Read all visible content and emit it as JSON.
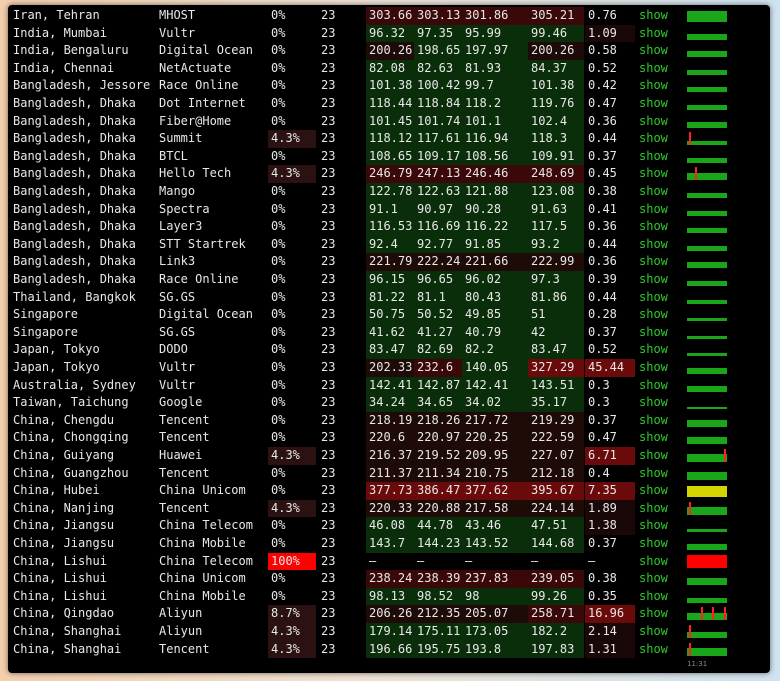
{
  "rows": [
    {
      "location": "Iran, Tehran",
      "provider": "MHOST",
      "loss": "0%",
      "count": "23",
      "avg": "303.66",
      "best": "303.13",
      "median": "301.86",
      "worst": "305.21",
      "stdev": "0.76",
      "show": "show",
      "graph": {
        "level": 0.85,
        "color": "#1aa61a",
        "spikes": []
      }
    },
    {
      "location": "India, Mumbai",
      "provider": "Vultr",
      "loss": "0%",
      "count": "23",
      "avg": "96.32",
      "best": "97.35",
      "median": "95.99",
      "worst": "99.46",
      "stdev": "1.09",
      "show": "show",
      "graph": {
        "level": 0.4,
        "color": "#1aa61a",
        "spikes": []
      }
    },
    {
      "location": "India, Bengaluru",
      "provider": "Digital Ocean",
      "loss": "0%",
      "count": "23",
      "avg": "200.26",
      "best": "198.65",
      "median": "197.97",
      "worst": "200.26",
      "stdev": "0.58",
      "show": "show",
      "graph": {
        "level": 0.5,
        "color": "#1aa61a",
        "spikes": []
      }
    },
    {
      "location": "India, Chennai",
      "provider": "NetActuate",
      "loss": "0%",
      "count": "23",
      "avg": "82.08",
      "best": "82.63",
      "median": "81.93",
      "worst": "84.37",
      "stdev": "0.52",
      "show": "show",
      "graph": {
        "level": 0.4,
        "color": "#1aa61a",
        "spikes": []
      }
    },
    {
      "location": "Bangladesh, Jessore",
      "provider": "Race Online",
      "loss": "0%",
      "count": "23",
      "avg": "101.38",
      "best": "100.42",
      "median": "99.7",
      "worst": "101.38",
      "stdev": "0.42",
      "show": "show",
      "graph": {
        "level": 0.4,
        "color": "#1aa61a",
        "spikes": []
      }
    },
    {
      "location": "Bangladesh, Dhaka",
      "provider": "Dot Internet",
      "loss": "0%",
      "count": "23",
      "avg": "118.44",
      "best": "118.84",
      "median": "118.2",
      "worst": "119.76",
      "stdev": "0.47",
      "show": "show",
      "graph": {
        "level": 0.4,
        "color": "#1aa61a",
        "spikes": []
      }
    },
    {
      "location": "Bangladesh, Dhaka",
      "provider": "Fiber@Home",
      "loss": "0%",
      "count": "23",
      "avg": "101.45",
      "best": "101.74",
      "median": "101.1",
      "worst": "102.4",
      "stdev": "0.36",
      "show": "show",
      "graph": {
        "level": 0.4,
        "color": "#1aa61a",
        "spikes": []
      }
    },
    {
      "location": "Bangladesh, Dhaka",
      "provider": "Summit",
      "loss": "4.3%",
      "count": "23",
      "avg": "118.12",
      "best": "117.61",
      "median": "116.94",
      "worst": "118.3",
      "stdev": "0.44",
      "show": "show",
      "graph": {
        "level": 0.35,
        "color": "#1aa61a",
        "spikes": [
          0.06
        ]
      }
    },
    {
      "location": "Bangladesh, Dhaka",
      "provider": "BTCL",
      "loss": "0%",
      "count": "23",
      "avg": "108.65",
      "best": "109.17",
      "median": "108.56",
      "worst": "109.91",
      "stdev": "0.37",
      "show": "show",
      "graph": {
        "level": 0.4,
        "color": "#1aa61a",
        "spikes": []
      }
    },
    {
      "location": "Bangladesh, Dhaka",
      "provider": "Hello Tech",
      "loss": "4.3%",
      "count": "23",
      "avg": "246.79",
      "best": "247.13",
      "median": "246.46",
      "worst": "248.69",
      "stdev": "0.45",
      "show": "show",
      "graph": {
        "level": 0.55,
        "color": "#1aa61a",
        "spikes": [
          0.2
        ]
      }
    },
    {
      "location": "Bangladesh, Dhaka",
      "provider": "Mango",
      "loss": "0%",
      "count": "23",
      "avg": "122.78",
      "best": "122.63",
      "median": "121.88",
      "worst": "123.08",
      "stdev": "0.38",
      "show": "show",
      "graph": {
        "level": 0.4,
        "color": "#1aa61a",
        "spikes": []
      }
    },
    {
      "location": "Bangladesh, Dhaka",
      "provider": "Spectra",
      "loss": "0%",
      "count": "23",
      "avg": "91.1",
      "best": "90.97",
      "median": "90.28",
      "worst": "91.63",
      "stdev": "0.41",
      "show": "show",
      "graph": {
        "level": 0.35,
        "color": "#1aa61a",
        "spikes": []
      }
    },
    {
      "location": "Bangladesh, Dhaka",
      "provider": "Layer3",
      "loss": "0%",
      "count": "23",
      "avg": "116.53",
      "best": "116.69",
      "median": "116.22",
      "worst": "117.5",
      "stdev": "0.36",
      "show": "show",
      "graph": {
        "level": 0.4,
        "color": "#1aa61a",
        "spikes": []
      }
    },
    {
      "location": "Bangladesh, Dhaka",
      "provider": "STT Startrek",
      "loss": "0%",
      "count": "23",
      "avg": "92.4",
      "best": "92.77",
      "median": "91.85",
      "worst": "93.2",
      "stdev": "0.44",
      "show": "show",
      "graph": {
        "level": 0.35,
        "color": "#1aa61a",
        "spikes": []
      }
    },
    {
      "location": "Bangladesh, Dhaka",
      "provider": "Link3",
      "loss": "0%",
      "count": "23",
      "avg": "221.79",
      "best": "222.24",
      "median": "221.66",
      "worst": "222.99",
      "stdev": "0.36",
      "show": "show",
      "graph": {
        "level": 0.5,
        "color": "#1aa61a",
        "spikes": []
      }
    },
    {
      "location": "Bangladesh, Dhaka",
      "provider": "Race Online",
      "loss": "0%",
      "count": "23",
      "avg": "96.15",
      "best": "96.65",
      "median": "96.02",
      "worst": "97.3",
      "stdev": "0.39",
      "show": "show",
      "graph": {
        "level": 0.35,
        "color": "#1aa61a",
        "spikes": []
      }
    },
    {
      "location": "Thailand, Bangkok",
      "provider": "SG.GS",
      "loss": "0%",
      "count": "23",
      "avg": "81.22",
      "best": "81.1",
      "median": "80.43",
      "worst": "81.86",
      "stdev": "0.44",
      "show": "show",
      "graph": {
        "level": 0.3,
        "color": "#1aa61a",
        "spikes": []
      }
    },
    {
      "location": "Singapore",
      "provider": "Digital Ocean",
      "loss": "0%",
      "count": "23",
      "avg": "50.75",
      "best": "50.52",
      "median": "49.85",
      "worst": "51",
      "stdev": "0.28",
      "show": "show",
      "graph": {
        "level": 0.25,
        "color": "#1aa61a",
        "spikes": []
      }
    },
    {
      "location": "Singapore",
      "provider": "SG.GS",
      "loss": "0%",
      "count": "23",
      "avg": "41.62",
      "best": "41.27",
      "median": "40.79",
      "worst": "42",
      "stdev": "0.37",
      "show": "show",
      "graph": {
        "level": 0.2,
        "color": "#1aa61a",
        "spikes": []
      }
    },
    {
      "location": "Japan, Tokyo",
      "provider": "DODO",
      "loss": "0%",
      "count": "23",
      "avg": "83.47",
      "best": "82.69",
      "median": "82.2",
      "worst": "83.47",
      "stdev": "0.52",
      "show": "show",
      "graph": {
        "level": 0.3,
        "color": "#1aa61a",
        "spikes": []
      }
    },
    {
      "location": "Japan, Tokyo",
      "provider": "Vultr",
      "loss": "0%",
      "count": "23",
      "avg": "202.33",
      "best": "232.6",
      "median": "140.05",
      "worst": "327.29",
      "stdev": "45.44",
      "show": "show",
      "graph": {
        "level": 0.45,
        "color": "#1aa61a",
        "spikes": []
      }
    },
    {
      "location": "Australia, Sydney",
      "provider": "Vultr",
      "loss": "0%",
      "count": "23",
      "avg": "142.41",
      "best": "142.87",
      "median": "142.41",
      "worst": "143.51",
      "stdev": "0.3",
      "show": "show",
      "graph": {
        "level": 0.45,
        "color": "#1aa61a",
        "spikes": []
      }
    },
    {
      "location": "Taiwan, Taichung",
      "provider": "Google",
      "loss": "0%",
      "count": "23",
      "avg": "34.24",
      "best": "34.65",
      "median": "34.02",
      "worst": "35.17",
      "stdev": "0.3",
      "show": "show",
      "graph": {
        "level": 0.2,
        "color": "#1aa61a",
        "spikes": []
      }
    },
    {
      "location": "China, Chengdu",
      "provider": "Tencent",
      "loss": "0%",
      "count": "23",
      "avg": "218.19",
      "best": "218.26",
      "median": "217.72",
      "worst": "219.29",
      "stdev": "0.37",
      "show": "show",
      "graph": {
        "level": 0.55,
        "color": "#1aa61a",
        "spikes": []
      }
    },
    {
      "location": "China, Chongqing",
      "provider": "Tencent",
      "loss": "0%",
      "count": "23",
      "avg": "220.6",
      "best": "220.97",
      "median": "220.25",
      "worst": "222.59",
      "stdev": "0.47",
      "show": "show",
      "graph": {
        "level": 0.55,
        "color": "#1aa61a",
        "spikes": []
      }
    },
    {
      "location": "China, Guiyang",
      "provider": "Huawei",
      "loss": "4.3%",
      "count": "23",
      "avg": "216.37",
      "best": "219.52",
      "median": "209.95",
      "worst": "227.07",
      "stdev": "6.71",
      "show": "show",
      "graph": {
        "level": 0.6,
        "color": "#1aa61a",
        "spikes": [
          0.92
        ]
      }
    },
    {
      "location": "China, Guangzhou",
      "provider": "Tencent",
      "loss": "0%",
      "count": "23",
      "avg": "211.37",
      "best": "211.34",
      "median": "210.75",
      "worst": "212.18",
      "stdev": "0.4",
      "show": "show",
      "graph": {
        "level": 0.55,
        "color": "#1aa61a",
        "spikes": []
      }
    },
    {
      "location": "China, Hubei",
      "provider": "China Unicom",
      "loss": "0%",
      "count": "23",
      "avg": "377.73",
      "best": "386.47",
      "median": "377.62",
      "worst": "395.67",
      "stdev": "7.35",
      "show": "show",
      "graph": {
        "level": 0.85,
        "color": "#d4d400",
        "spikes": []
      }
    },
    {
      "location": "China, Nanjing",
      "provider": "Tencent",
      "loss": "4.3%",
      "count": "23",
      "avg": "220.33",
      "best": "220.88",
      "median": "217.58",
      "worst": "224.14",
      "stdev": "1.89",
      "show": "show",
      "graph": {
        "level": 0.6,
        "color": "#1aa61a",
        "spikes": [
          0.06
        ]
      }
    },
    {
      "location": "China, Jiangsu",
      "provider": "China Telecom",
      "loss": "0%",
      "count": "23",
      "avg": "46.08",
      "best": "44.78",
      "median": "43.46",
      "worst": "47.51",
      "stdev": "1.38",
      "show": "show",
      "graph": {
        "level": 0.25,
        "color": "#1aa61a",
        "spikes": []
      }
    },
    {
      "location": "China, Jiangsu",
      "provider": "China Mobile",
      "loss": "0%",
      "count": "23",
      "avg": "143.7",
      "best": "144.23",
      "median": "143.52",
      "worst": "144.68",
      "stdev": "0.37",
      "show": "show",
      "graph": {
        "level": 0.45,
        "color": "#1aa61a",
        "spikes": []
      }
    },
    {
      "location": "China, Lishui",
      "provider": "China Telecom",
      "loss": "100%",
      "count": "23",
      "avg": "–",
      "best": "–",
      "median": "–",
      "worst": "–",
      "stdev": "–",
      "show": "show",
      "graph": {
        "level": 1,
        "color": "#ff0000",
        "spikes": []
      }
    },
    {
      "location": "China, Lishui",
      "provider": "China Unicom",
      "loss": "0%",
      "count": "23",
      "avg": "238.24",
      "best": "238.39",
      "median": "237.83",
      "worst": "239.05",
      "stdev": "0.38",
      "show": "show",
      "graph": {
        "level": 0.55,
        "color": "#1aa61a",
        "spikes": []
      }
    },
    {
      "location": "China, Lishui",
      "provider": "China Mobile",
      "loss": "0%",
      "count": "23",
      "avg": "98.13",
      "best": "98.52",
      "median": "98",
      "worst": "99.26",
      "stdev": "0.35",
      "show": "show",
      "graph": {
        "level": 0.35,
        "color": "#1aa61a",
        "spikes": []
      }
    },
    {
      "location": "China, Qingdao",
      "provider": "Aliyun",
      "loss": "8.7%",
      "count": "23",
      "avg": "206.26",
      "best": "212.35",
      "median": "205.07",
      "worst": "258.71",
      "stdev": "16.96",
      "show": "show",
      "graph": {
        "level": 0.6,
        "color": "#1aa61a",
        "spikes": [
          0.35,
          0.62,
          0.92
        ]
      }
    },
    {
      "location": "China, Shanghai",
      "provider": "Aliyun",
      "loss": "4.3%",
      "count": "23",
      "avg": "179.14",
      "best": "175.11",
      "median": "173.05",
      "worst": "182.2",
      "stdev": "2.14",
      "show": "show",
      "graph": {
        "level": 0.5,
        "color": "#1aa61a",
        "spikes": [
          0.06
        ]
      }
    },
    {
      "location": "China, Shanghai",
      "provider": "Tencent",
      "loss": "4.3%",
      "count": "23",
      "avg": "196.66",
      "best": "195.75",
      "median": "193.8",
      "worst": "197.83",
      "stdev": "1.31",
      "show": "show",
      "graph": {
        "level": 0.55,
        "color": "#1aa61a",
        "spikes": [
          0.04
        ]
      }
    }
  ],
  "graph_note": "11:31"
}
